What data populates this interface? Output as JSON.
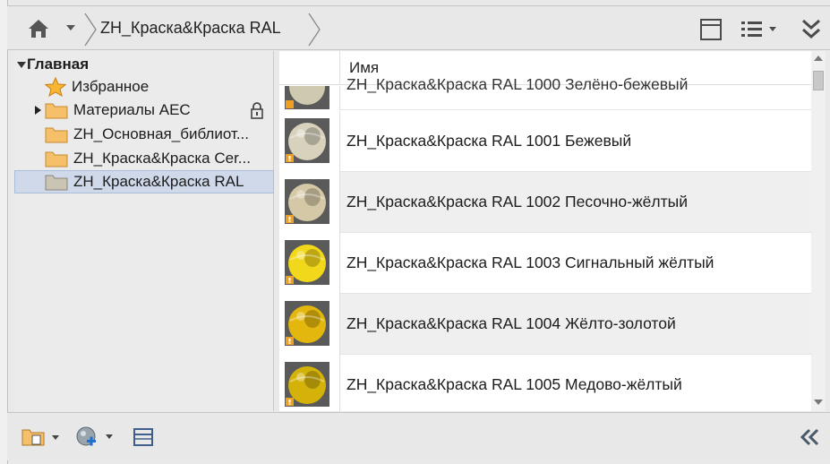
{
  "breadcrumb": {
    "current": "ZH_Краска&Краска RAL"
  },
  "toolbar": {
    "icons": [
      "home-icon",
      "dropdown-arrow-icon",
      "panel-toggle-icon",
      "list-view-icon",
      "expand-more-icon"
    ]
  },
  "tree": {
    "root_label": "Главная",
    "items": [
      {
        "label": "Избранное",
        "icon": "star-icon"
      },
      {
        "label": "Материалы AEC",
        "icon": "folder-icon",
        "locked": true
      },
      {
        "label": "ZH_Основная_библиот...",
        "icon": "folder-icon"
      },
      {
        "label": "ZH_Краска&Краска Cer...",
        "icon": "folder-icon"
      },
      {
        "label": "ZH_Краска&Краска RAL",
        "icon": "folder-icon",
        "selected": true
      }
    ]
  },
  "list": {
    "header_name": "Имя",
    "partial_row_text": "ZH_Краска&Краска RAL 1000 Зелёно-бежевый",
    "rows": [
      {
        "name": "ZH_Краска&Краска RAL 1001 Бежевый",
        "color": "#d8d2bd"
      },
      {
        "name": "ZH_Краска&Краска RAL 1002 Песочно-жёлтый",
        "color": "#d5c8a6"
      },
      {
        "name": "ZH_Краска&Краска RAL 1003 Сигнальный жёлтый",
        "color": "#f2d81a"
      },
      {
        "name": "ZH_Краска&Краска RAL 1004 Жёлто-золотой",
        "color": "#e3b70e"
      },
      {
        "name": "ZH_Краска&Краска RAL 1005 Медово-жёлтый",
        "color": "#d4b20a"
      }
    ]
  },
  "bottombar": {
    "icons": [
      "library-folder-icon",
      "create-material-icon",
      "panel-icon",
      "collapse-left-icon"
    ]
  },
  "colors": {
    "selection": "#cfd9ea",
    "folder": "#f2b35a",
    "star": "#f5a623"
  }
}
